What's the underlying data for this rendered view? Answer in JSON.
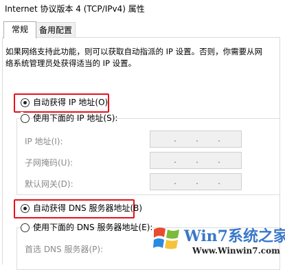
{
  "window": {
    "title": "Internet 协议版本 4 (TCP/IPv4) 属性"
  },
  "tabs": [
    {
      "label": "常规",
      "active": true
    },
    {
      "label": "备用配置",
      "active": false
    }
  ],
  "description": "如果网络支持此功能，则可以获取自动指派的 IP 设置。否则，你需要从网络系统管理员处获得适当的 IP 设置。",
  "ip_section": {
    "auto_label": "自动获得 IP 地址(O)",
    "auto_checked": true,
    "manual_label": "使用下面的 IP 地址(S):",
    "manual_checked": false,
    "fields": [
      {
        "label": "IP 地址(I):",
        "value": ". . ."
      },
      {
        "label": "子网掩码(U):",
        "value": ". . ."
      },
      {
        "label": "默认网关(D):",
        "value": ". . ."
      }
    ]
  },
  "dns_section": {
    "auto_label": "自动获得 DNS 服务器地址(B)",
    "auto_checked": true,
    "manual_label": "使用下面的 DNS 服务器地址(E):",
    "manual_checked": false,
    "fields": [
      {
        "label": "首选 DNS 服务器(P):"
      }
    ]
  },
  "colors": {
    "highlight": "#e5101b",
    "watermark_blue": "#3a78c8"
  },
  "watermark": {
    "brand": "Win7系统之家",
    "url": "Www.Winwin7.com"
  }
}
